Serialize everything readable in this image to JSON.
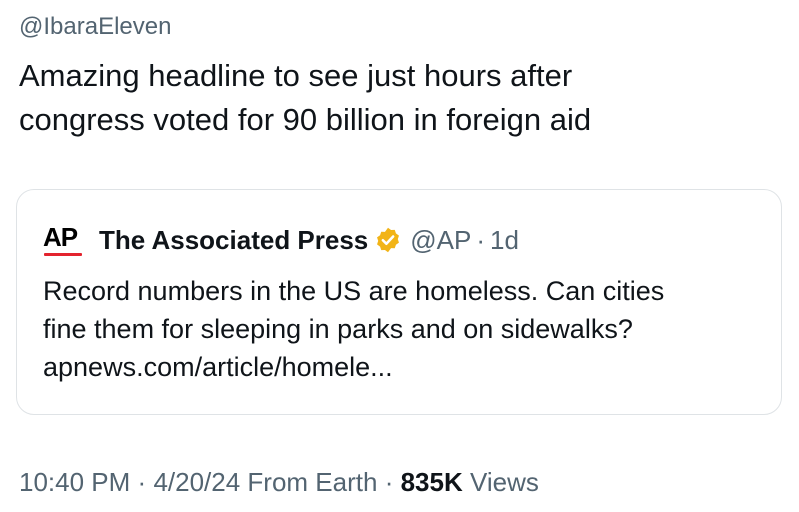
{
  "tweet": {
    "handle": "@IbaraEleven",
    "text_lines": [
      "Amazing headline to see just hours after",
      "congress voted for 90 billion in foreign aid"
    ]
  },
  "quote": {
    "logo_text": "AP",
    "display_name": "The Associated Press",
    "verified_badge_color": "#f2b417",
    "handle": "@AP",
    "separator": "·",
    "time_ago": "1d",
    "body_lines": [
      "Record numbers in the US are homeless. Can cities",
      "fine them for sleeping in parks and on sidewalks?",
      "apnews.com/article/homele..."
    ]
  },
  "meta": {
    "time": "10:40 PM",
    "separator_1": "·",
    "date": "4/20/24",
    "source": "From Earth",
    "separator_2": "·",
    "views_count": "835K",
    "views_label": "Views"
  },
  "colors": {
    "secondary_text": "#536471",
    "primary_text": "#0f1419",
    "ap_red": "#e3232e",
    "card_border": "#dfe3e6"
  }
}
